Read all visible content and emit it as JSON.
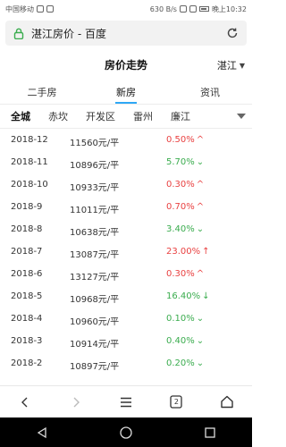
{
  "status_bar": {
    "carrier": "中国移动",
    "network_speed": "630 B/s",
    "time": "晚上10:32"
  },
  "browser": {
    "address_title": "湛江房价 - 百度"
  },
  "header": {
    "title": "房价走势",
    "city": "湛江"
  },
  "main_tabs": [
    {
      "label": "二手房",
      "active": false
    },
    {
      "label": "新房",
      "active": true
    },
    {
      "label": "资讯",
      "active": false
    }
  ],
  "districts": [
    {
      "label": "全城",
      "active": true
    },
    {
      "label": "赤坎",
      "active": false
    },
    {
      "label": "开发区",
      "active": false
    },
    {
      "label": "雷州",
      "active": false
    },
    {
      "label": "廉江",
      "active": false
    }
  ],
  "price_rows": [
    {
      "month": "2018-12",
      "price": "11560元/平",
      "change": "0.50%",
      "direction": "up"
    },
    {
      "month": "2018-11",
      "price": "10896元/平",
      "change": "5.70%",
      "direction": "down"
    },
    {
      "month": "2018-10",
      "price": "10933元/平",
      "change": "0.30%",
      "direction": "up"
    },
    {
      "month": "2018-9",
      "price": "11011元/平",
      "change": "0.70%",
      "direction": "up"
    },
    {
      "month": "2018-8",
      "price": "10638元/平",
      "change": "3.40%",
      "direction": "down"
    },
    {
      "month": "2018-7",
      "price": "13087元/平",
      "change": "23.00%",
      "direction": "up"
    },
    {
      "month": "2018-6",
      "price": "13127元/平",
      "change": "0.30%",
      "direction": "up"
    },
    {
      "month": "2018-5",
      "price": "10968元/平",
      "change": "16.40%",
      "direction": "down"
    },
    {
      "month": "2018-4",
      "price": "10960元/平",
      "change": "0.10%",
      "direction": "down"
    },
    {
      "month": "2018-3",
      "price": "10914元/平",
      "change": "0.40%",
      "direction": "down"
    },
    {
      "month": "2018-2",
      "price": "10897元/平",
      "change": "0.20%",
      "direction": "down"
    }
  ],
  "colors": {
    "up": "#e94141",
    "down": "#3aac4e",
    "accent": "#2ea8f6"
  },
  "icons": {
    "lock": "lock-icon",
    "refresh": "refresh-icon",
    "back": "chevron-left-icon",
    "forward": "chevron-right-icon",
    "menu": "menu-icon",
    "tabs": "tab-count-icon",
    "home": "home-icon"
  },
  "toolbar": {
    "tab_count": "2"
  }
}
